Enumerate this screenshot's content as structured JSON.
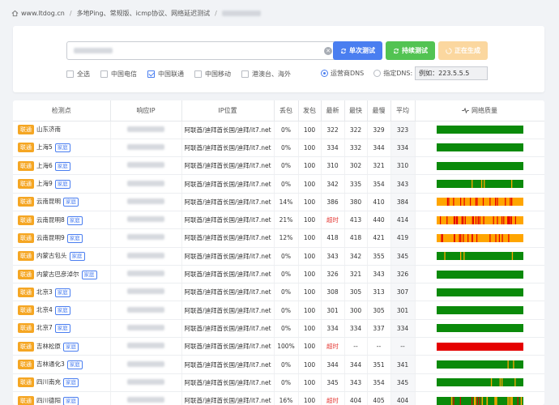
{
  "breadcrumb": {
    "site": "www.ltdog.cn",
    "page": "多地Ping、常规版、icmp协议、网络延迟测试"
  },
  "controls": {
    "clear_glyph": "✕",
    "btn_single": "单次测试",
    "btn_continuous": "持续测试",
    "btn_generating": "正在生成",
    "filters": [
      {
        "label": "全选",
        "checked": false
      },
      {
        "label": "中国电信",
        "checked": false
      },
      {
        "label": "中国联通",
        "checked": true
      },
      {
        "label": "中国移动",
        "checked": false
      },
      {
        "label": "港澳台、海外",
        "checked": false
      }
    ],
    "dns_operator": "运营商DNS",
    "dns_custom": "指定DNS:",
    "dns_value": "例如：223.5.5.5"
  },
  "table": {
    "headers": [
      "检测点",
      "响应IP",
      "IP位置",
      "丢包",
      "发包",
      "最新",
      "最快",
      "最慢",
      "平均",
      "网络质量"
    ],
    "quality_icon": "pulse-icon",
    "rows": [
      {
        "isp": "联通",
        "node": "山东济南",
        "tag": "",
        "loc": "阿联酋/迪拜酋长国/迪拜/it7.net",
        "loss": "0%",
        "sent": "100",
        "latest": "322",
        "fast": "322",
        "slow": "329",
        "avg": "323",
        "q": "g"
      },
      {
        "isp": "联通",
        "node": "上海5",
        "tag": "家庭",
        "loc": "阿联酋/迪拜酋长国/迪拜/it7.net",
        "loss": "0%",
        "sent": "100",
        "latest": "334",
        "fast": "332",
        "slow": "344",
        "avg": "334",
        "q": "g"
      },
      {
        "isp": "联通",
        "node": "上海6",
        "tag": "家庭",
        "loc": "阿联酋/迪拜酋长国/迪拜/it7.net",
        "loss": "0%",
        "sent": "100",
        "latest": "310",
        "fast": "302",
        "slow": "321",
        "avg": "310",
        "q": "g"
      },
      {
        "isp": "联通",
        "node": "上海9",
        "tag": "家庭",
        "loc": "阿联酋/迪拜酋长国/迪拜/it7.net",
        "loss": "0%",
        "sent": "100",
        "latest": "342",
        "fast": "335",
        "slow": "354",
        "avg": "343",
        "q": "gy"
      },
      {
        "isp": "联通",
        "node": "云南昆明",
        "tag": "家庭",
        "loc": "阿联酋/迪拜酋长国/迪拜/it7.net",
        "loss": "14%",
        "sent": "100",
        "latest": "386",
        "fast": "380",
        "slow": "410",
        "avg": "384",
        "q": "or"
      },
      {
        "isp": "联通",
        "node": "云南昆明8",
        "tag": "家庭",
        "loc": "阿联酋/迪拜酋长国/迪拜/it7.net",
        "loss": "21%",
        "sent": "100",
        "latest": "超时",
        "fast": "413",
        "slow": "440",
        "avg": "414",
        "q": "orr"
      },
      {
        "isp": "联通",
        "node": "云南昆明9",
        "tag": "家庭",
        "loc": "阿联酋/迪拜酋长国/迪拜/it7.net",
        "loss": "12%",
        "sent": "100",
        "latest": "418",
        "fast": "418",
        "slow": "421",
        "avg": "419",
        "q": "or"
      },
      {
        "isp": "联通",
        "node": "内蒙古包头",
        "tag": "家庭",
        "loc": "阿联酋/迪拜酋长国/迪拜/it7.net",
        "loss": "0%",
        "sent": "100",
        "latest": "343",
        "fast": "342",
        "slow": "355",
        "avg": "345",
        "q": "gy"
      },
      {
        "isp": "联通",
        "node": "内蒙古巴彦淖尔",
        "tag": "家庭",
        "loc": "阿联酋/迪拜酋长国/迪拜/it7.net",
        "loss": "0%",
        "sent": "100",
        "latest": "326",
        "fast": "321",
        "slow": "343",
        "avg": "326",
        "q": "g"
      },
      {
        "isp": "联通",
        "node": "北京3",
        "tag": "家庭",
        "loc": "阿联酋/迪拜酋长国/迪拜/it7.net",
        "loss": "0%",
        "sent": "100",
        "latest": "308",
        "fast": "305",
        "slow": "313",
        "avg": "307",
        "q": "g"
      },
      {
        "isp": "联通",
        "node": "北京4",
        "tag": "家庭",
        "loc": "阿联酋/迪拜酋长国/迪拜/it7.net",
        "loss": "0%",
        "sent": "100",
        "latest": "301",
        "fast": "300",
        "slow": "305",
        "avg": "301",
        "q": "g"
      },
      {
        "isp": "联通",
        "node": "北京7",
        "tag": "家庭",
        "loc": "阿联酋/迪拜酋长国/迪拜/it7.net",
        "loss": "0%",
        "sent": "100",
        "latest": "334",
        "fast": "334",
        "slow": "337",
        "avg": "334",
        "q": "g"
      },
      {
        "isp": "联通",
        "node": "吉林松原",
        "tag": "家庭",
        "loc": "阿联酋/迪拜酋长国/迪拜/it7.net",
        "loss": "100%",
        "sent": "100",
        "latest": "超时",
        "fast": "--",
        "slow": "--",
        "avg": "--",
        "q": "r"
      },
      {
        "isp": "联通",
        "node": "吉林通化3",
        "tag": "家庭",
        "loc": "阿联酋/迪拜酋长国/迪拜/it7.net",
        "loss": "0%",
        "sent": "100",
        "latest": "344",
        "fast": "344",
        "slow": "351",
        "avg": "341",
        "q": "gy1"
      },
      {
        "isp": "联通",
        "node": "四川南充",
        "tag": "家庭",
        "loc": "阿联酋/迪拜酋长国/迪拜/it7.net",
        "loss": "0%",
        "sent": "100",
        "latest": "345",
        "fast": "343",
        "slow": "354",
        "avg": "345",
        "q": "gy"
      },
      {
        "isp": "联通",
        "node": "四川德阳",
        "tag": "家庭",
        "loc": "阿联酋/迪拜酋长国/迪拜/it7.net",
        "loss": "16%",
        "sent": "100",
        "latest": "超时",
        "fast": "404",
        "slow": "405",
        "avg": "404",
        "q": "gor"
      }
    ]
  },
  "colors": {
    "good": "#0a8a0a",
    "warn": "#ffa500",
    "bad": "#e50000",
    "accent": "#4a7ef0",
    "isp": "#f5a623"
  }
}
